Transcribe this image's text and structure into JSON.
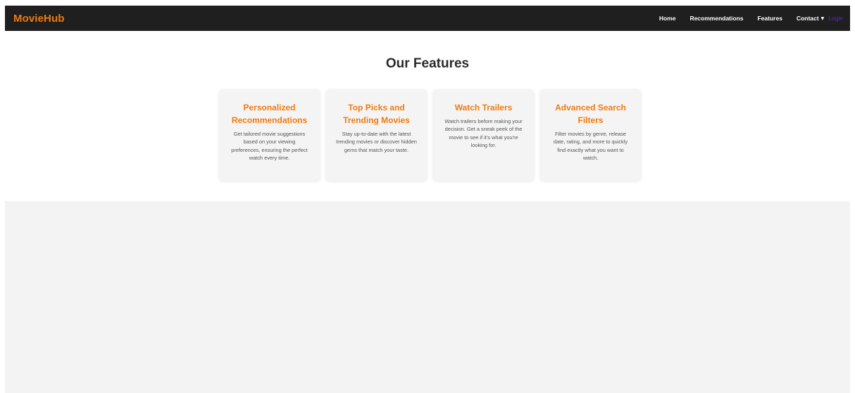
{
  "navbar": {
    "brand": "MovieHub",
    "links": [
      "Home",
      "Recommendations",
      "Features"
    ],
    "contact_label": "Contact",
    "login_label": "Login"
  },
  "colors": {
    "accent": "#f07a10",
    "navbar_bg": "#1f1f1f",
    "login_link": "#5a2bb8",
    "card_bg": "#f4f4f4",
    "lower_bg": "#f3f3f3"
  },
  "features": {
    "title": "Our Features",
    "cards": [
      {
        "title": "Personalized Recommendations",
        "text": "Get tailored movie suggestions based on your viewing preferences, ensuring the perfect watch every time."
      },
      {
        "title": "Top Picks and Trending Movies",
        "text": "Stay up-to-date with the latest trending movies or discover hidden gems that match your taste."
      },
      {
        "title": "Watch Trailers",
        "text": "Watch trailers before making your decision. Get a sneak peek of the movie to see if it's what you're looking for."
      },
      {
        "title": "Advanced Search Filters",
        "text": "Filter movies by genre, release date, rating, and more to quickly find exactly what you want to watch."
      }
    ]
  }
}
